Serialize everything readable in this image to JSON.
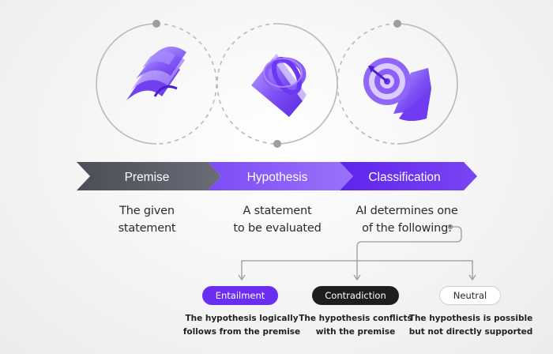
{
  "steps": [
    {
      "label": "Premise",
      "description_lines": [
        "The given",
        "statement"
      ],
      "icon": "papers-icon",
      "color": "#5b5d68"
    },
    {
      "label": "Hypothesis",
      "description_lines": [
        "A statement",
        "to be evaluated"
      ],
      "icon": "rings-icon",
      "color": "#8354f7"
    },
    {
      "label": "Classification",
      "description_lines": [
        "AI determines one",
        "of the following:"
      ],
      "icon": "target-icon",
      "color": "#6a2ef0"
    }
  ],
  "outcomes": [
    {
      "label": "Entailment",
      "style": "filled-purple",
      "description_lines": [
        "The hypothesis logically",
        "follows from the premise"
      ]
    },
    {
      "label": "Contradiction",
      "style": "filled-dark",
      "description_lines": [
        "The hypothesis conflicts",
        "with the premise"
      ]
    },
    {
      "label": "Neutral",
      "style": "outline",
      "description_lines": [
        "The hypothesis is possible",
        "but not directly supported"
      ]
    }
  ],
  "colors": {
    "accent": "#6a2ef0",
    "dark": "#1e1e1e",
    "connector": "#9a9a9a"
  }
}
